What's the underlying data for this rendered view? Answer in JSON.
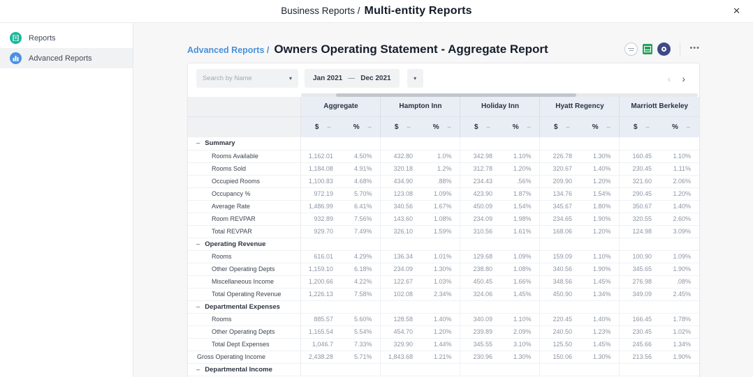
{
  "colors": {
    "accent_link": "#4a90d9",
    "reports_icon": "#17b89a",
    "advanced_reports_icon": "#4a90e2",
    "excel_icon": "#28a05c",
    "settings_icon": "#3e4a86"
  },
  "app_header": {
    "breadcrumb_prefix": "Business Reports /",
    "title": "Multi-entity Reports",
    "close_glyph": "✕"
  },
  "sidebar": {
    "items": [
      {
        "label": "Reports"
      },
      {
        "label": "Advanced Reports"
      }
    ]
  },
  "report": {
    "breadcrumb_link": "Advanced Reports /",
    "title": "Owners Operating Statement - Aggregate Report",
    "more_glyph": "•••"
  },
  "filters": {
    "search_placeholder": "Search by Name",
    "date_from": "Jan 2021",
    "date_separator": "—",
    "date_to": "Dec 2021",
    "caret_glyph": "▾"
  },
  "pagination": {
    "prev_glyph": "‹",
    "next_glyph": "›"
  },
  "table": {
    "entities": [
      "Aggregate",
      "Hampton Inn",
      "Holiday Inn",
      "Hyatt Regency",
      "Marriott Berkeley"
    ],
    "subheaders": {
      "dollar": "$",
      "percent": "%",
      "sort_glyph": "–"
    },
    "section_collapse_glyph": "–",
    "rows": [
      {
        "type": "section",
        "label": "Summary"
      },
      {
        "type": "data",
        "label": "Rooms Available",
        "values": [
          [
            "1,162.01",
            "4.50%"
          ],
          [
            "432.80",
            "1.0%"
          ],
          [
            "342.98",
            "1.10%"
          ],
          [
            "226.78",
            "1.30%"
          ],
          [
            "160.45",
            "1.10%"
          ]
        ]
      },
      {
        "type": "data",
        "label": "Rooms Sold",
        "values": [
          [
            "1,184.08",
            "4.91%"
          ],
          [
            "320.18",
            "1.2%"
          ],
          [
            "312.78",
            "1.20%"
          ],
          [
            "320.67",
            "1.40%"
          ],
          [
            "230.45",
            "1.11%"
          ]
        ]
      },
      {
        "type": "data",
        "label": "Occupied Rooms",
        "values": [
          [
            "1,100.83",
            "4.68%"
          ],
          [
            "434.90",
            ".88%"
          ],
          [
            "234.43",
            ".56%"
          ],
          [
            "209.90",
            "1.20%"
          ],
          [
            "321.60",
            "2.06%"
          ]
        ]
      },
      {
        "type": "data",
        "label": "Occupancy %",
        "values": [
          [
            "972.19",
            "5.70%"
          ],
          [
            "123.08",
            "1.09%"
          ],
          [
            "423.90",
            "1.87%"
          ],
          [
            "134.76",
            "1.54%"
          ],
          [
            "290.45",
            "1.20%"
          ]
        ]
      },
      {
        "type": "data",
        "label": "Average Rate",
        "values": [
          [
            "1,486.99",
            "6.41%"
          ],
          [
            "340.56",
            "1.67%"
          ],
          [
            "450.09",
            "1.54%"
          ],
          [
            "345.67",
            "1.80%"
          ],
          [
            "350.67",
            "1.40%"
          ]
        ]
      },
      {
        "type": "data",
        "label": "Room REVPAR",
        "values": [
          [
            "932.89",
            "7.56%"
          ],
          [
            "143.60",
            "1.08%"
          ],
          [
            "234.09",
            "1.98%"
          ],
          [
            "234.65",
            "1.90%"
          ],
          [
            "320.55",
            "2.60%"
          ]
        ]
      },
      {
        "type": "data",
        "label": "Total REVPAR",
        "values": [
          [
            "929.70",
            "7.49%"
          ],
          [
            "326.10",
            "1.59%"
          ],
          [
            "310.56",
            "1.61%"
          ],
          [
            "168.06",
            "1.20%"
          ],
          [
            "124.98",
            "3.09%"
          ]
        ]
      },
      {
        "type": "section",
        "label": "Operating Revenue"
      },
      {
        "type": "data",
        "label": "Rooms",
        "values": [
          [
            "616.01",
            "4.29%"
          ],
          [
            "136.34",
            "1.01%"
          ],
          [
            "129.68",
            "1.09%"
          ],
          [
            "159.09",
            "1.10%"
          ],
          [
            "100.90",
            "1.09%"
          ]
        ]
      },
      {
        "type": "data",
        "label": "Other Operating Depts",
        "values": [
          [
            "1,159.10",
            "6.18%"
          ],
          [
            "234.09",
            "1.30%"
          ],
          [
            "238.80",
            "1.08%"
          ],
          [
            "340.56",
            "1.90%"
          ],
          [
            "345.65",
            "1.90%"
          ]
        ]
      },
      {
        "type": "data",
        "label": "Miscellaneous Income",
        "values": [
          [
            "1,200.66",
            "4.22%"
          ],
          [
            "122.67",
            "1.03%"
          ],
          [
            "450.45",
            "1.66%"
          ],
          [
            "348.56",
            "1.45%"
          ],
          [
            "276.98",
            ".08%"
          ]
        ]
      },
      {
        "type": "data",
        "label": "Total Operating Revenue",
        "values": [
          [
            "1,226.13",
            "7.58%"
          ],
          [
            "102.08",
            "2.34%"
          ],
          [
            "324.06",
            "1.45%"
          ],
          [
            "450.90",
            "1.34%"
          ],
          [
            "349.09",
            "2.45%"
          ]
        ]
      },
      {
        "type": "section",
        "label": "Departmental Expenses"
      },
      {
        "type": "data",
        "label": "Rooms",
        "values": [
          [
            "885.57",
            "5.60%"
          ],
          [
            "128.58",
            "1.40%"
          ],
          [
            "340.09",
            "1.10%"
          ],
          [
            "220.45",
            "1.40%"
          ],
          [
            "166.45",
            "1.78%"
          ]
        ]
      },
      {
        "type": "data",
        "label": "Other Operating Depts",
        "values": [
          [
            "1,165.54",
            "5.54%"
          ],
          [
            "454.70",
            "1.20%"
          ],
          [
            "239.89",
            "2.09%"
          ],
          [
            "240.50",
            "1.23%"
          ],
          [
            "230.45",
            "1.02%"
          ]
        ]
      },
      {
        "type": "data",
        "label": "Total Dept Expenses",
        "values": [
          [
            "1,046.7",
            "7.33%"
          ],
          [
            "329.90",
            "1.44%"
          ],
          [
            "345.55",
            "3.10%"
          ],
          [
            "125.50",
            "1.45%"
          ],
          [
            "245.66",
            "1.34%"
          ]
        ]
      },
      {
        "type": "total",
        "label": "Gross Operating Income",
        "values": [
          [
            "2,438.28",
            "5.71%"
          ],
          [
            "1,843.68",
            "1.21%"
          ],
          [
            "230.96",
            "1.30%"
          ],
          [
            "150.06",
            "1.30%"
          ],
          [
            "213.56",
            "1.90%"
          ]
        ]
      },
      {
        "type": "section",
        "label": "Departmental Income"
      }
    ]
  }
}
